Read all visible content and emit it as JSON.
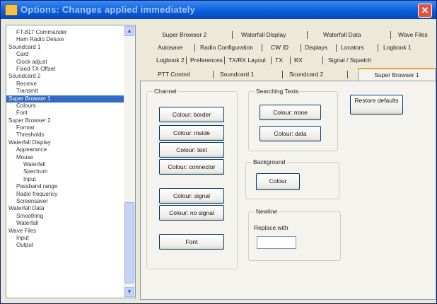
{
  "window": {
    "title": "Options: Changes applied immediately",
    "close_glyph": "✕"
  },
  "tree": {
    "items": [
      {
        "label": "FT-817 Commander",
        "level": 1
      },
      {
        "label": "Ham Radio Deluxe",
        "level": 1
      },
      {
        "label": "Soundcard 1",
        "level": 0
      },
      {
        "label": "Card",
        "level": 1
      },
      {
        "label": "Clock adjust",
        "level": 1
      },
      {
        "label": "Fixed TX Offset",
        "level": 1
      },
      {
        "label": "Soundcard 2",
        "level": 0
      },
      {
        "label": "Receive",
        "level": 1
      },
      {
        "label": "Transmit",
        "level": 1
      },
      {
        "label": "Super Browser 1",
        "level": 0,
        "selected": true
      },
      {
        "label": "Colours",
        "level": 1
      },
      {
        "label": "Font",
        "level": 1
      },
      {
        "label": "Super Browser 2",
        "level": 0
      },
      {
        "label": "Format",
        "level": 1
      },
      {
        "label": "Thresholds",
        "level": 1
      },
      {
        "label": "Waterfall Display",
        "level": 0
      },
      {
        "label": "Appearance",
        "level": 1
      },
      {
        "label": "Mouse",
        "level": 1
      },
      {
        "label": "Waterfall",
        "level": 2
      },
      {
        "label": "Spectrum",
        "level": 2
      },
      {
        "label": "Input",
        "level": 2
      },
      {
        "label": "Passband range",
        "level": 1
      },
      {
        "label": "Radio frequency",
        "level": 1
      },
      {
        "label": "Screensaver",
        "level": 1
      },
      {
        "label": "Waterfall Data",
        "level": 0
      },
      {
        "label": "Smoothing",
        "level": 1
      },
      {
        "label": "Waterfall",
        "level": 1
      },
      {
        "label": "Wave Files",
        "level": 0
      },
      {
        "label": "Input",
        "level": 1
      },
      {
        "label": "Output",
        "level": 1
      }
    ],
    "scroll_up": "▲",
    "scroll_down": "▼"
  },
  "tabs": {
    "row1": [
      "Super Browser 2",
      "Waterfall Display",
      "Waterfall Data",
      "Wave Files"
    ],
    "row2": [
      "Autosave",
      "Radio Configuration",
      "CW ID",
      "Displays",
      "Locators",
      "Logbook 1"
    ],
    "row3": [
      "Logbook 2",
      "Preferences",
      "TX/RX Layout",
      "TX",
      "RX",
      "Signal / Squelch"
    ],
    "row4": [
      "PTT Control",
      "Soundcard 1",
      "Soundcard 2"
    ],
    "active": "Super Browser 1"
  },
  "channel": {
    "legend": "Channel",
    "buttons": [
      "Colour: border",
      "Colour: inside",
      "Colour: text",
      "Colour: connector",
      "Colour: signal",
      "Colour: no signal",
      "Font"
    ]
  },
  "searching": {
    "legend": "Searching Texts",
    "buttons": [
      "Colour: none",
      "Colour: data"
    ]
  },
  "restore_defaults": "Restore defaults",
  "background": {
    "legend": "Background",
    "button": "Colour"
  },
  "newline": {
    "legend": "Newline",
    "label": "Replace with",
    "value": ""
  },
  "colors": {
    "titlebar": "#0a5fd8",
    "selection": "#316ac5",
    "panel": "#f4f3ee",
    "window": "#ece9d8"
  }
}
